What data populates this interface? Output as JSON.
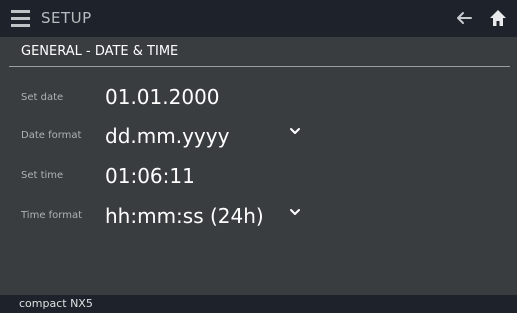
{
  "header": {
    "menu_icon": "menu-icon",
    "title": "SETUP",
    "back_icon": "arrow-left-icon",
    "home_icon": "home-icon"
  },
  "section": {
    "title": "GENERAL - DATE & TIME"
  },
  "rows": [
    {
      "label": "Set date",
      "value": "01.01.2000",
      "has_dropdown": false
    },
    {
      "label": "Date format",
      "value": "dd.mm.yyyy",
      "has_dropdown": true
    },
    {
      "label": "Set time",
      "value": "01:06:11",
      "has_dropdown": false
    },
    {
      "label": "Time format",
      "value": "hh:mm:ss (24h)",
      "has_dropdown": true
    }
  ],
  "footer": {
    "device": "compact NX5"
  },
  "colors": {
    "header_bg": "#1e232b",
    "panel_bg": "#3a3d40",
    "label_gray": "#aeb2b5"
  }
}
